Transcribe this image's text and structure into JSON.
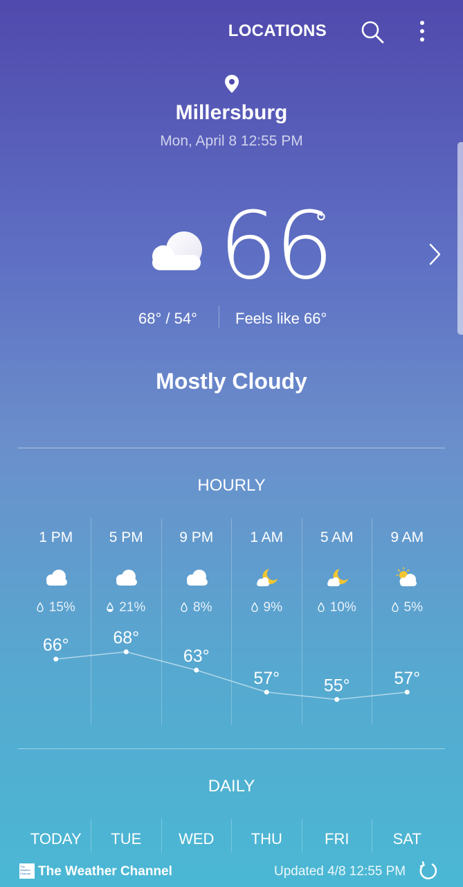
{
  "header": {
    "locations_label": "LOCATIONS",
    "icons": [
      "search-icon",
      "more-vert-icon"
    ]
  },
  "location": {
    "city": "Millersburg",
    "datetime": "Mon, April 8 12:55 PM"
  },
  "current": {
    "temperature": "66",
    "degree": "°",
    "hilo": "68°  /  54°",
    "feels_like": "Feels like 66°",
    "condition": "Mostly Cloudy",
    "icon": "cloud-icon"
  },
  "hourly": {
    "title": "HOURLY",
    "items": [
      {
        "time": "1 PM",
        "icon": "cloud-icon",
        "precip": "15%",
        "temp": "66°",
        "value": 66
      },
      {
        "time": "5 PM",
        "icon": "cloud-icon",
        "precip": "21%",
        "temp": "68°",
        "value": 68
      },
      {
        "time": "9 PM",
        "icon": "cloud-icon",
        "precip": "8%",
        "temp": "63°",
        "value": 63
      },
      {
        "time": "1 AM",
        "icon": "moon-cloud-icon",
        "precip": "9%",
        "temp": "57°",
        "value": 57
      },
      {
        "time": "5 AM",
        "icon": "moon-cloud-icon",
        "precip": "10%",
        "temp": "55°",
        "value": 55
      },
      {
        "time": "9 AM",
        "icon": "sun-cloud-icon",
        "precip": "5%",
        "temp": "57°",
        "value": 57
      }
    ]
  },
  "daily": {
    "title": "DAILY",
    "days": [
      "TODAY",
      "TUE",
      "WED",
      "THU",
      "FRI",
      "SAT"
    ]
  },
  "footer": {
    "logo_text": "The Weather Channel",
    "brand": "The Weather Channel",
    "updated": "Updated  4/8  12:55 PM"
  },
  "colors": {
    "gradient_top": "#5049ad",
    "gradient_bottom": "#4ab8d4",
    "moon": "#f2c531",
    "text": "#ffffff"
  }
}
